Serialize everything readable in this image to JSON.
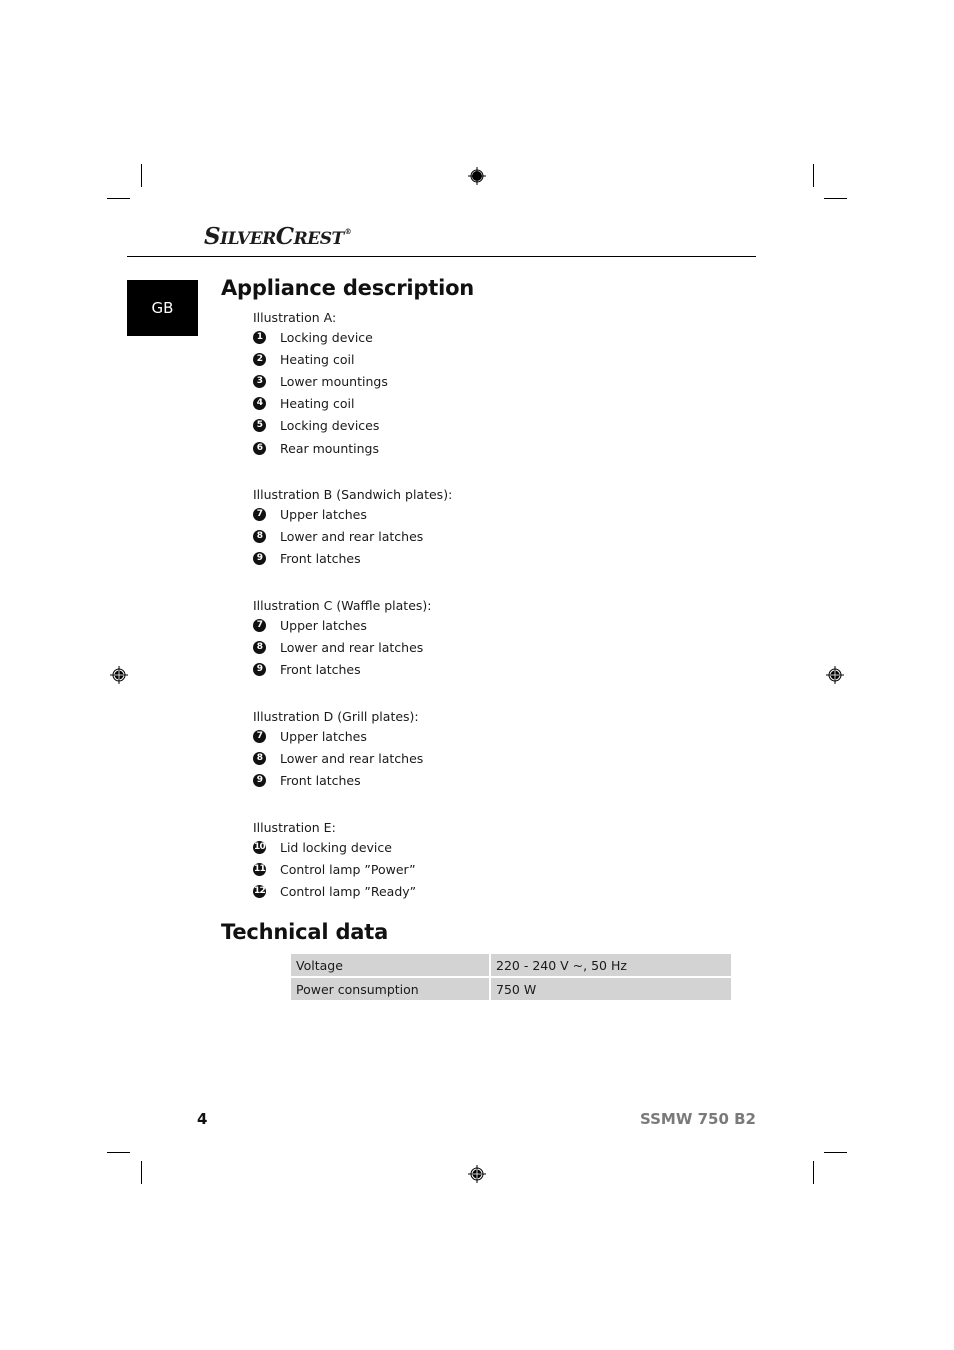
{
  "brand": {
    "logo_parts": [
      "S",
      "ILVER",
      "C",
      "REST"
    ],
    "registered": "®"
  },
  "language_tab": "GB",
  "appliance_description": {
    "title": "Appliance description",
    "groups": [
      {
        "caption": "Illustration A:",
        "items": [
          {
            "number": "1",
            "label": "Locking device"
          },
          {
            "number": "2",
            "label": "Heating coil"
          },
          {
            "number": "3",
            "label": "Lower mountings"
          },
          {
            "number": "4",
            "label": "Heating coil"
          },
          {
            "number": "5",
            "label": "Locking devices"
          },
          {
            "number": "6",
            "label": "Rear mountings"
          }
        ]
      },
      {
        "caption": "Illustration B (Sandwich plates):",
        "items": [
          {
            "number": "7",
            "label": "Upper latches"
          },
          {
            "number": "8",
            "label": "Lower and rear latches"
          },
          {
            "number": "9",
            "label": "Front latches"
          }
        ]
      },
      {
        "caption": "Illustration C (Waffle plates):",
        "items": [
          {
            "number": "7",
            "label": "Upper latches"
          },
          {
            "number": "8",
            "label": "Lower and rear latches"
          },
          {
            "number": "9",
            "label": "Front latches"
          }
        ]
      },
      {
        "caption": "Illustration D (Grill plates):",
        "items": [
          {
            "number": "7",
            "label": "Upper latches"
          },
          {
            "number": "8",
            "label": "Lower and rear latches"
          },
          {
            "number": "9",
            "label": "Front latches"
          }
        ]
      },
      {
        "caption": "Illustration E:",
        "items": [
          {
            "number": "10",
            "label": "Lid locking device"
          },
          {
            "number": "11",
            "label": "Control lamp ”Power”"
          },
          {
            "number": "12",
            "label": "Control lamp ”Ready”"
          }
        ]
      }
    ]
  },
  "technical_data": {
    "title": "Technical data",
    "rows": [
      {
        "key": "Voltage",
        "value": "220 - 240 V ~, 50 Hz"
      },
      {
        "key": "Power consumption",
        "value": "750 W"
      }
    ]
  },
  "footer": {
    "page_number": "4",
    "model": "SSMW 750 B2"
  },
  "icons": {
    "registration_mark": "crosshair-registration-icon",
    "item_number": "filled-circle-number"
  }
}
